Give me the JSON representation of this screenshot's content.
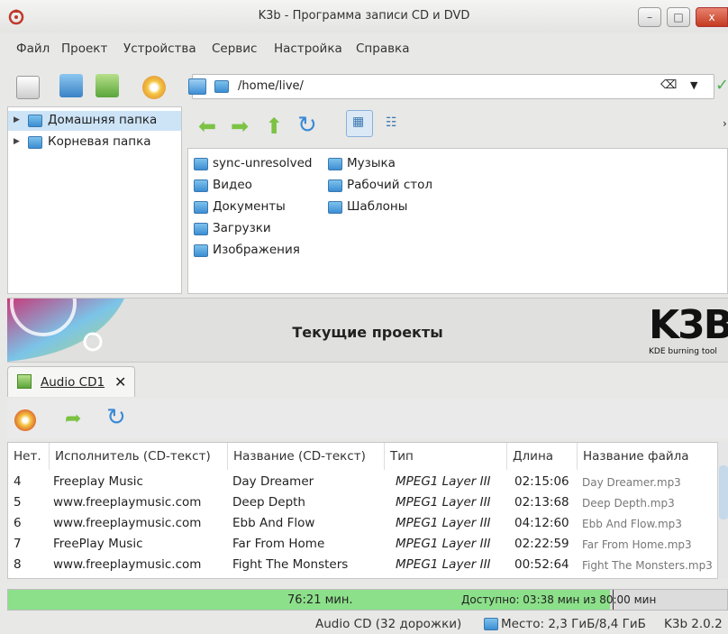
{
  "window": {
    "title": "K3b - Программа записи CD и DVD",
    "minimize": "–",
    "maximize": "□",
    "close": "x"
  },
  "menu": [
    "Файл",
    "Проект",
    "Устройства",
    "Сервис",
    "Настройка",
    "Справка"
  ],
  "toolbar": {
    "path": "/home/live/"
  },
  "tree": [
    {
      "label": "Домашняя папка",
      "selected": true
    },
    {
      "label": "Корневая папка",
      "selected": false
    }
  ],
  "files": [
    {
      "name": "sync-unresolved",
      "col": 0,
      "row": 0
    },
    {
      "name": "Видео",
      "col": 0,
      "row": 1
    },
    {
      "name": "Документы",
      "col": 0,
      "row": 2
    },
    {
      "name": "Загрузки",
      "col": 0,
      "row": 3
    },
    {
      "name": "Изображения",
      "col": 0,
      "row": 4
    },
    {
      "name": "Музыка",
      "col": 1,
      "row": 0
    },
    {
      "name": "Рабочий стол",
      "col": 1,
      "row": 1
    },
    {
      "name": "Шаблоны",
      "col": 1,
      "row": 2
    }
  ],
  "banner": {
    "title": "Текущие проекты",
    "logo": "K3B",
    "logo_sub": "KDE burning tool"
  },
  "tab": {
    "label": "Audio CD1",
    "close": "✕"
  },
  "table": {
    "headers": [
      "Нет.",
      "Исполнитель (CD-текст)",
      "Название (CD-текст)",
      "Тип",
      "Длина",
      "Название файла"
    ],
    "rows": [
      {
        "no": "4",
        "artist": "Freeplay Music",
        "title": "Day Dreamer",
        "type": "MPEG1 Layer III",
        "length": "02:15:06",
        "file": "Day Dreamer.mp3"
      },
      {
        "no": "5",
        "artist": "www.freeplaymusic.com",
        "title": "Deep Depth",
        "type": "MPEG1 Layer III",
        "length": "02:13:68",
        "file": "Deep Depth.mp3"
      },
      {
        "no": "6",
        "artist": "www.freeplaymusic.com",
        "title": "Ebb And Flow",
        "type": "MPEG1 Layer III",
        "length": "04:12:60",
        "file": "Ebb And Flow.mp3"
      },
      {
        "no": "7",
        "artist": "FreePlay Music",
        "title": "Far From Home",
        "type": "MPEG1 Layer III",
        "length": "02:22:59",
        "file": "Far From Home.mp3"
      },
      {
        "no": "8",
        "artist": "www.freeplaymusic.com",
        "title": "Fight The Monsters",
        "type": "MPEG1 Layer III",
        "length": "00:52:64",
        "file": "Fight The Monsters.mp3"
      }
    ]
  },
  "progress": {
    "used": "76:21 мин.",
    "available": "Доступно: 03:38 мин из 80:00 мин",
    "fraction": 0.8375,
    "color": "#8ce08a"
  },
  "status": {
    "project_type": "Audio CD (32 дорожки)",
    "space": "Место: 2,3 ГиБ/8,4 ГиБ",
    "version": "K3b 2.0.2"
  }
}
